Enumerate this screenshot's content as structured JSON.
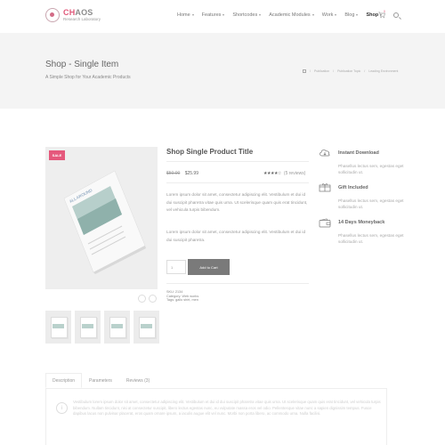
{
  "logo": {
    "name_accent": "CH",
    "name_rest": "AOS",
    "subtitle": "Research Laboratory"
  },
  "nav": {
    "items": [
      {
        "label": "Home",
        "has_caret": true,
        "active": false
      },
      {
        "label": "Features",
        "has_caret": true,
        "active": false
      },
      {
        "label": "Shortcodes",
        "has_caret": true,
        "active": false
      },
      {
        "label": "Academic Modules",
        "has_caret": true,
        "active": false
      },
      {
        "label": "Work",
        "has_caret": true,
        "active": false
      },
      {
        "label": "Blog",
        "has_caret": true,
        "active": false
      },
      {
        "label": "Shop",
        "has_caret": true,
        "active": true
      }
    ],
    "cart_count": "0",
    "cart_icon": "cart-icon",
    "search_icon": "search-icon"
  },
  "hero": {
    "title": "Shop - Single Item",
    "subtitle": "A Simple Shop for Your Academic Products",
    "breadcrumb": [
      "Publication",
      "Publication Topic",
      "Leading Environment"
    ]
  },
  "product": {
    "sale_badge": "SALE",
    "cover_label": "ALL AROUND",
    "title": "Shop Single Product Title",
    "old_price": "$50.00",
    "new_price": "$25.99",
    "rating_stars": "★★★★☆",
    "rating_value": 4.5,
    "reviews": "(5 reviews)",
    "desc1": "Lorem ipsum dolor sit amet, consectetur adipiscing elit. Vestibulum et dui id dui suscipit pharetra vitae quis urna. Ut scelerisque quam quis erat tincidunt, vel vehicula turpis bibendum.",
    "desc2": "Lorem ipsum dolor sit amet, consectetur adipiscing elit. Vestibulum et dui id dui suscipit pharetra.",
    "qty": "1",
    "add_to_cart": "Add to Cart",
    "sku": "SKU: 2134",
    "category": "Category: Web works",
    "tags": "Tags: gallo shirt, men"
  },
  "features": [
    {
      "icon": "cloud-download-icon",
      "title": "Instant Download",
      "text": "Phasellus lectus sem, egestas eget sollicitudin ut."
    },
    {
      "icon": "gift-icon",
      "title": "Gift Included",
      "text": "Phasellus lectus sem, egestas eget sollicitudin ut."
    },
    {
      "icon": "wallet-icon",
      "title": "14 Days Moneyback",
      "text": "Phasellus lectus sem, egestas eget sollicitudin ut."
    }
  ],
  "tabs": [
    {
      "label": "Description",
      "active": true
    },
    {
      "label": "Parameters",
      "active": false
    },
    {
      "label": "Reviews (3)",
      "active": false
    }
  ],
  "tab_content": "Vestibulum lorem ipsum dolor sit amet, consectetur adipiscing elit. Vestibulum et dui id dui suscipit pharetra vitae quis urna. Ut scelerisque quam quis erat tincidunt, vel vehicula turpis bibendum. Nullam tincidunt, nisi at consectetur suscipit, libero lectus egestas nunc, eu vulputate massa eros vel odio. Pellentesque vitae nunc a sapien dignissim tempus. Fusce dapibus lacus non pulvinar placerat, eros quam ornare ipsum, a iaculis augue elit vel nunc. Morbi non porta libero, ac commodo urna. Nulla facilisi."
}
